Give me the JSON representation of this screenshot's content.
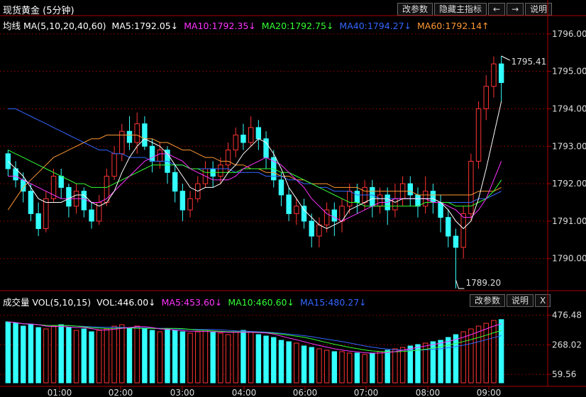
{
  "header": {
    "title": "现货黄金 (5分钟)",
    "buttons": [
      "改参数",
      "隐藏主指标",
      "←",
      "→",
      "说明"
    ]
  },
  "ma_legend": {
    "label": "均线 MA(5,10,20,40,60)",
    "items": [
      {
        "text": "MA5:1792.05↓",
        "color": "#ffffff"
      },
      {
        "text": "MA10:1792.35↓",
        "color": "#ff33ff"
      },
      {
        "text": "MA20:1792.75↓",
        "color": "#33ff33"
      },
      {
        "text": "MA40:1794.27↓",
        "color": "#3366ff"
      },
      {
        "text": "MA60:1792.14↑",
        "color": "#ff9933"
      }
    ]
  },
  "vol_panel": {
    "label": "成交量 VOL(5,10,15)",
    "vol_text": "VOL:446.00↓",
    "items": [
      {
        "text": "MA5:453.60↓",
        "color": "#ff33ff"
      },
      {
        "text": "MA10:460.60↓",
        "color": "#33ff33"
      },
      {
        "text": "MA15:480.27↓",
        "color": "#3366ff"
      }
    ],
    "buttons": [
      "改参数",
      "说明",
      "X"
    ],
    "ticks": [
      "476.48",
      "268.02",
      "59.56"
    ]
  },
  "price_axis": {
    "ticks": [
      "1796.00",
      "1795.00",
      "1794.00",
      "1793.00",
      "1792.00",
      "1791.00",
      "1790.00"
    ]
  },
  "time_axis": {
    "ticks": [
      "01:00",
      "02:00",
      "03:00",
      "04:00",
      "06:00",
      "07:00",
      "08:00",
      "09:00"
    ]
  },
  "annotations": {
    "high": "1795.41",
    "low": "1789.20"
  },
  "colors": {
    "up": "#ff3333",
    "down": "#33ffff",
    "grid": "#7a0000",
    "border": "#aa0000"
  },
  "chart_data": {
    "type": "candlestick",
    "ylim": [
      1789.2,
      1796.3
    ],
    "candles": [
      [
        1792.8,
        1792.4,
        1792.9,
        1792.2
      ],
      [
        1792.4,
        1792.1,
        1792.6,
        1791.9
      ],
      [
        1792.1,
        1791.8,
        1792.3,
        1791.5
      ],
      [
        1791.8,
        1791.2,
        1792.0,
        1791.0
      ],
      [
        1791.2,
        1790.8,
        1791.5,
        1790.6
      ],
      [
        1790.8,
        1791.6,
        1791.8,
        1790.7
      ],
      [
        1791.6,
        1792.2,
        1792.4,
        1791.5
      ],
      [
        1792.2,
        1791.9,
        1792.4,
        1791.6
      ],
      [
        1791.9,
        1791.4,
        1792.0,
        1791.1
      ],
      [
        1791.4,
        1791.8,
        1792.0,
        1791.2
      ],
      [
        1791.8,
        1791.3,
        1791.9,
        1791.1
      ],
      [
        1791.3,
        1791.0,
        1791.5,
        1790.8
      ],
      [
        1791.0,
        1791.5,
        1791.7,
        1790.9
      ],
      [
        1791.5,
        1792.2,
        1792.4,
        1791.4
      ],
      [
        1792.2,
        1792.8,
        1793.0,
        1792.1
      ],
      [
        1792.8,
        1793.4,
        1793.6,
        1792.6
      ],
      [
        1793.4,
        1793.1,
        1793.8,
        1792.9
      ],
      [
        1793.1,
        1793.6,
        1793.9,
        1792.8
      ],
      [
        1793.6,
        1793.0,
        1793.8,
        1792.9
      ],
      [
        1793.0,
        1792.6,
        1793.2,
        1792.3
      ],
      [
        1792.6,
        1792.9,
        1793.1,
        1792.4
      ],
      [
        1792.9,
        1792.3,
        1793.0,
        1792.0
      ],
      [
        1792.3,
        1791.8,
        1792.5,
        1791.5
      ],
      [
        1791.8,
        1791.3,
        1792.0,
        1791.0
      ],
      [
        1791.3,
        1791.6,
        1791.8,
        1791.1
      ],
      [
        1791.6,
        1792.0,
        1792.2,
        1791.5
      ],
      [
        1792.0,
        1792.4,
        1792.6,
        1791.9
      ],
      [
        1792.4,
        1792.2,
        1792.6,
        1791.9
      ],
      [
        1792.2,
        1792.5,
        1792.7,
        1792.0
      ],
      [
        1792.5,
        1792.9,
        1793.1,
        1792.3
      ],
      [
        1792.9,
        1793.3,
        1793.5,
        1792.7
      ],
      [
        1793.3,
        1793.1,
        1793.6,
        1792.9
      ],
      [
        1793.1,
        1793.5,
        1793.8,
        1793.0
      ],
      [
        1793.5,
        1793.2,
        1793.7,
        1792.9
      ],
      [
        1793.2,
        1792.7,
        1793.4,
        1792.4
      ],
      [
        1792.7,
        1792.1,
        1792.9,
        1791.9
      ],
      [
        1792.1,
        1791.7,
        1792.3,
        1791.4
      ],
      [
        1791.7,
        1791.2,
        1791.9,
        1791.0
      ],
      [
        1791.2,
        1791.4,
        1791.6,
        1790.9
      ],
      [
        1791.4,
        1791.0,
        1791.6,
        1790.8
      ],
      [
        1791.0,
        1790.6,
        1791.2,
        1790.3
      ],
      [
        1790.6,
        1790.9,
        1791.1,
        1790.3
      ],
      [
        1790.9,
        1791.3,
        1791.5,
        1790.7
      ],
      [
        1791.3,
        1791.0,
        1791.5,
        1790.6
      ],
      [
        1791.0,
        1791.4,
        1791.6,
        1790.7
      ],
      [
        1791.4,
        1791.8,
        1792.0,
        1791.2
      ],
      [
        1791.8,
        1791.5,
        1792.0,
        1791.2
      ],
      [
        1791.5,
        1791.9,
        1792.1,
        1791.3
      ],
      [
        1791.9,
        1791.4,
        1792.1,
        1791.1
      ],
      [
        1791.4,
        1791.7,
        1791.9,
        1791.2
      ],
      [
        1791.7,
        1791.3,
        1791.9,
        1790.9
      ],
      [
        1791.3,
        1791.6,
        1792.0,
        1791.1
      ],
      [
        1791.6,
        1792.0,
        1792.2,
        1791.4
      ],
      [
        1792.0,
        1791.7,
        1792.2,
        1791.4
      ],
      [
        1791.7,
        1791.4,
        1791.9,
        1791.1
      ],
      [
        1791.4,
        1791.8,
        1792.2,
        1791.2
      ],
      [
        1791.8,
        1791.5,
        1792.0,
        1791.2
      ],
      [
        1791.5,
        1791.1,
        1791.7,
        1790.7
      ],
      [
        1791.1,
        1790.6,
        1791.3,
        1790.3
      ],
      [
        1790.6,
        1790.3,
        1790.8,
        1789.2
      ],
      [
        1790.3,
        1791.2,
        1791.4,
        1790.0
      ],
      [
        1791.2,
        1792.6,
        1792.8,
        1791.0
      ],
      [
        1792.6,
        1794.0,
        1794.2,
        1792.4
      ],
      [
        1794.0,
        1794.6,
        1794.9,
        1793.7
      ],
      [
        1794.6,
        1795.2,
        1795.4,
        1794.3
      ],
      [
        1795.2,
        1794.7,
        1795.41,
        1794.2
      ]
    ],
    "ma5": [
      1792.6,
      1792.4,
      1792.2,
      1791.9,
      1791.6,
      1791.5,
      1791.5,
      1791.5,
      1791.6,
      1791.7,
      1791.7,
      1791.5,
      1791.4,
      1791.5,
      1791.8,
      1792.3,
      1792.7,
      1793.0,
      1793.2,
      1793.1,
      1793.0,
      1792.8,
      1792.5,
      1792.2,
      1791.9,
      1791.8,
      1791.9,
      1791.9,
      1792.0,
      1792.3,
      1792.5,
      1792.8,
      1793.0,
      1793.2,
      1793.1,
      1792.8,
      1792.4,
      1791.9,
      1791.6,
      1791.3,
      1791.1,
      1790.9,
      1790.8,
      1790.9,
      1791.0,
      1791.3,
      1791.4,
      1791.5,
      1791.6,
      1791.6,
      1791.6,
      1791.5,
      1791.6,
      1791.6,
      1791.6,
      1791.6,
      1791.6,
      1791.5,
      1791.3,
      1791.0,
      1790.8,
      1791.0,
      1791.6,
      1792.4,
      1793.3,
      1794.2
    ],
    "ma10": [
      1792.2,
      1792.2,
      1792.1,
      1792.0,
      1791.9,
      1791.8,
      1791.7,
      1791.6,
      1791.6,
      1791.6,
      1791.6,
      1791.5,
      1791.5,
      1791.6,
      1791.8,
      1792.0,
      1792.2,
      1792.4,
      1792.6,
      1792.7,
      1792.8,
      1792.8,
      1792.7,
      1792.6,
      1792.4,
      1792.3,
      1792.2,
      1792.1,
      1792.1,
      1792.1,
      1792.2,
      1792.4,
      1792.5,
      1792.6,
      1792.7,
      1792.6,
      1792.5,
      1792.3,
      1792.1,
      1791.9,
      1791.6,
      1791.4,
      1791.2,
      1791.1,
      1791.0,
      1791.1,
      1791.2,
      1791.3,
      1791.4,
      1791.5,
      1791.5,
      1791.6,
      1791.6,
      1791.6,
      1791.6,
      1791.6,
      1791.5,
      1791.5,
      1791.4,
      1791.3,
      1791.1,
      1791.1,
      1791.3,
      1791.6,
      1792.1,
      1792.6
    ],
    "ma20": [
      1792.9,
      1792.8,
      1792.7,
      1792.6,
      1792.5,
      1792.4,
      1792.3,
      1792.2,
      1792.1,
      1792.0,
      1792.0,
      1791.9,
      1791.9,
      1791.9,
      1792.0,
      1792.1,
      1792.2,
      1792.3,
      1792.4,
      1792.5,
      1792.5,
      1792.5,
      1792.5,
      1792.5,
      1792.4,
      1792.4,
      1792.3,
      1792.3,
      1792.3,
      1792.3,
      1792.3,
      1792.4,
      1792.4,
      1792.4,
      1792.4,
      1792.4,
      1792.3,
      1792.3,
      1792.2,
      1792.1,
      1792.0,
      1791.9,
      1791.8,
      1791.7,
      1791.6,
      1791.5,
      1791.5,
      1791.4,
      1791.4,
      1791.4,
      1791.4,
      1791.4,
      1791.4,
      1791.4,
      1791.4,
      1791.5,
      1791.5,
      1791.5,
      1791.5,
      1791.4,
      1791.4,
      1791.4,
      1791.5,
      1791.6,
      1791.8,
      1792.1
    ],
    "ma40": [
      1794.0,
      1794.0,
      1793.9,
      1793.8,
      1793.7,
      1793.6,
      1793.5,
      1793.4,
      1793.3,
      1793.2,
      1793.1,
      1793.0,
      1792.9,
      1792.9,
      1792.8,
      1792.8,
      1792.7,
      1792.7,
      1792.7,
      1792.6,
      1792.6,
      1792.6,
      1792.5,
      1792.5,
      1792.4,
      1792.4,
      1792.4,
      1792.4,
      1792.4,
      1792.4,
      1792.3,
      1792.3,
      1792.3,
      1792.3,
      1792.2,
      1792.2,
      1792.2,
      1792.1,
      1792.1,
      1792.0,
      1792.0,
      1791.9,
      1791.9,
      1791.8,
      1791.8,
      1791.8,
      1791.7,
      1791.7,
      1791.7,
      1791.6,
      1791.6,
      1791.6,
      1791.6,
      1791.6,
      1791.6,
      1791.6,
      1791.6,
      1791.5,
      1791.5,
      1791.5,
      1791.5,
      1791.5,
      1791.6,
      1791.6,
      1791.7,
      1791.8
    ],
    "ma60": [
      1791.3,
      1791.6,
      1791.9,
      1792.1,
      1792.3,
      1792.5,
      1792.7,
      1792.8,
      1792.9,
      1793.0,
      1793.1,
      1793.2,
      1793.2,
      1793.3,
      1793.3,
      1793.3,
      1793.3,
      1793.3,
      1793.2,
      1793.2,
      1793.1,
      1793.1,
      1793.0,
      1792.9,
      1792.9,
      1792.8,
      1792.7,
      1792.7,
      1792.6,
      1792.6,
      1792.5,
      1792.5,
      1792.4,
      1792.4,
      1792.3,
      1792.3,
      1792.2,
      1792.2,
      1792.1,
      1792.1,
      1792.0,
      1792.0,
      1792.0,
      1791.9,
      1791.9,
      1791.9,
      1791.9,
      1791.8,
      1791.8,
      1791.8,
      1791.8,
      1791.8,
      1791.8,
      1791.8,
      1791.7,
      1791.7,
      1791.7,
      1791.7,
      1791.7,
      1791.7,
      1791.7,
      1791.7,
      1791.8,
      1791.8,
      1791.8,
      1791.9
    ],
    "volume": [
      430,
      420,
      400,
      410,
      390,
      380,
      400,
      410,
      390,
      370,
      380,
      360,
      370,
      380,
      400,
      410,
      390,
      400,
      380,
      370,
      360,
      380,
      370,
      360,
      350,
      360,
      370,
      360,
      350,
      340,
      360,
      370,
      360,
      340,
      330,
      320,
      300,
      290,
      280,
      260,
      250,
      240,
      230,
      220,
      220,
      210,
      210,
      200,
      210,
      220,
      230,
      240,
      250,
      260,
      270,
      280,
      290,
      300,
      320,
      340,
      360,
      380,
      400,
      420,
      440,
      446
    ],
    "vol_ylim": [
      0,
      520
    ]
  }
}
